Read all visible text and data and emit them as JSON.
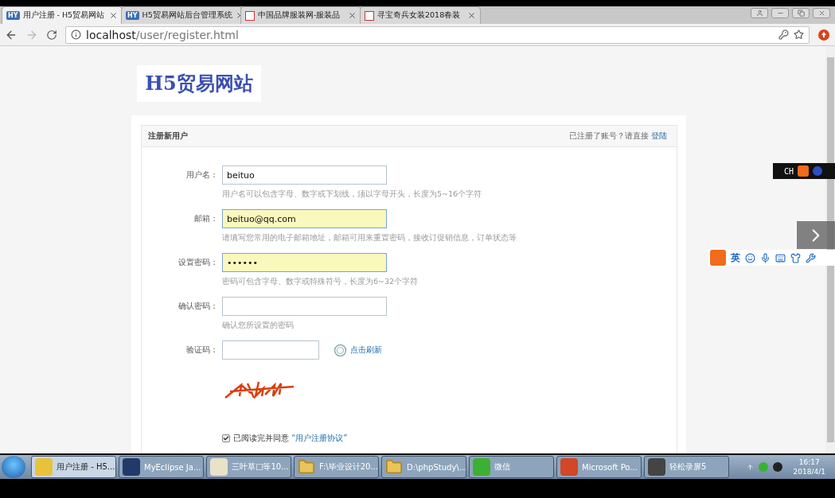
{
  "browser": {
    "tabs": [
      {
        "label": "用户注册 - H5贸易网站",
        "selected": true,
        "kind": "hy",
        "badge": "HY"
      },
      {
        "label": "H5贸易网站后台管理系统",
        "selected": false,
        "kind": "hy",
        "badge": "HY"
      },
      {
        "label": "中国品牌服装网-服装品",
        "selected": false,
        "kind": "site"
      },
      {
        "label": "寻宝奇兵女装2018春装",
        "selected": false,
        "kind": "site"
      }
    ],
    "url_host": "localhost",
    "url_path": "/user/register.html"
  },
  "page": {
    "logo": "H5贸易网站",
    "panel_title": "注册新用户",
    "login_prompt": "已注册了账号？请直接",
    "login_link": "登陆",
    "fields": [
      {
        "kind": "text",
        "label": "用户名：",
        "value": "beituo",
        "highlighted": false,
        "hint": "用户名可以包含字母、数字或下划线，须以字母开头，长度为5~16个字符"
      },
      {
        "kind": "text",
        "label": "邮箱：",
        "value": "beituo@qq.com",
        "highlighted": true,
        "hint": "请填写您常用的电子邮箱地址，邮箱可用来重置密码，接收订促销信息，订单状态等"
      },
      {
        "kind": "password",
        "label": "设置密码：",
        "value": "••••••",
        "highlighted": true,
        "hint": "密码可包含字母、数字或特殊符号，长度为6~32个字符"
      },
      {
        "kind": "password",
        "label": "确认密码：",
        "highlighted": false,
        "hint": "确认您所设置的密码"
      },
      {
        "kind": "captcha",
        "label": "验证码：",
        "highlighted": false,
        "refresh": "点击刷新"
      }
    ],
    "agreement": {
      "checked": true,
      "text": "已阅读完并同意",
      "link": "“用户注册协议”"
    }
  },
  "ime": {
    "toolbar": "CH",
    "mode": "英"
  },
  "taskbar": {
    "items": [
      {
        "kind": "chrome",
        "label": "用户注册 - H5...",
        "selected": true
      },
      {
        "kind": "eclipse",
        "label": "MyEclipse Ja...",
        "selected": false
      },
      {
        "kind": "app",
        "label": "三叶草□等10...",
        "selected": false
      },
      {
        "kind": "folder",
        "label": "F:\\毕业设计20...",
        "selected": false
      },
      {
        "kind": "folder",
        "label": "D:\\phpStudy\\...",
        "selected": false
      },
      {
        "kind": "wechat",
        "label": "微信",
        "selected": false
      },
      {
        "kind": "ppt",
        "label": "Microsoft Po...",
        "selected": false
      },
      {
        "kind": "recorder",
        "label": "轻松录屏5",
        "selected": false
      }
    ],
    "time": "16:17",
    "date": "2018/4/1"
  }
}
